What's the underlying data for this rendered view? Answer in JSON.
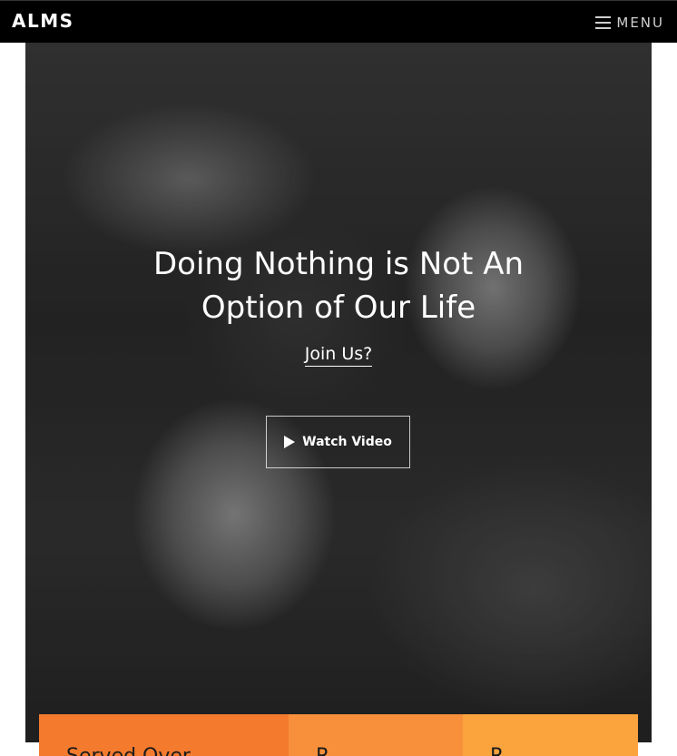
{
  "header": {
    "logo": "ALMS",
    "menu_label": "MENU",
    "menu_icon": "hamburger-icon"
  },
  "hero": {
    "title_line1": "Doing Nothing is Not An",
    "title_line2": "Option of Our Life",
    "join_link": "Join Us?",
    "watch_video_label": "Watch Video",
    "watch_video_icon": "play-icon"
  },
  "stats": {
    "items": [
      {
        "label": "Served Over",
        "color": "#f47a2e"
      },
      {
        "label": "R",
        "color": "#f8903b"
      },
      {
        "label": "R",
        "color": "#fba33d"
      }
    ]
  },
  "colors": {
    "header_bg": "#000000",
    "accent_orange": "#f47a2e"
  }
}
